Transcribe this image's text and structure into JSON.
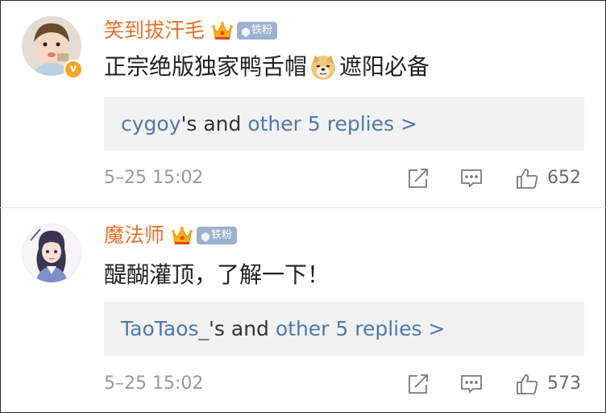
{
  "comments": [
    {
      "username": "笑到拔汗毛",
      "fan_badge": "铁粉",
      "text_before": "正宗绝版独家鸭舌帽",
      "text_after": "遮阳必备",
      "replies": {
        "user": "cygoy",
        "mid": "'s and ",
        "more": "other 5 replies >"
      },
      "timestamp": "5–25 15:02",
      "likes": "652",
      "verified_badge": "v"
    },
    {
      "username": "魔法师",
      "fan_badge": "铁粉",
      "text": "醍醐灌顶，了解一下！",
      "replies": {
        "user": "TaoTaos_",
        "mid": "'s and ",
        "more": "other 5 replies >"
      },
      "timestamp": "5–25 15:02",
      "likes": "573"
    }
  ],
  "icons": {
    "crown": "crown-icon",
    "share": "share-icon",
    "comment": "comment-icon",
    "like": "thumbs-up-icon",
    "doge": "doge-emoji-icon"
  },
  "colors": {
    "username": "#e8712b",
    "link": "#4c7ab0",
    "badge": "#9bb1cf",
    "reply_bg": "#f2f2f2",
    "meta": "#9a9a9a"
  }
}
